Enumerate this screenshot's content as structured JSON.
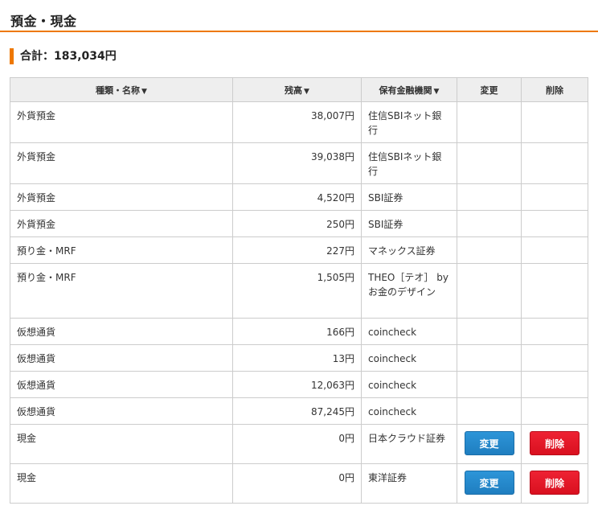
{
  "page": {
    "title": "預金・現金",
    "total": "合計：183,034円"
  },
  "table": {
    "headers": {
      "type_name": "種類・名称",
      "balance": "残高",
      "institution": "保有金融機関",
      "edit": "変更",
      "delete": "削除"
    },
    "sort_arrow": "▼",
    "rows": [
      {
        "type": "外貨預金",
        "amount": "38,007円",
        "institution": "住信SBIネット銀行",
        "actions": false
      },
      {
        "type": "外貨預金",
        "amount": "39,038円",
        "institution": "住信SBIネット銀行",
        "actions": false
      },
      {
        "type": "外貨預金",
        "amount": "4,520円",
        "institution": "SBI証券",
        "actions": false
      },
      {
        "type": "外貨預金",
        "amount": "250円",
        "institution": "SBI証券",
        "actions": false
      },
      {
        "type": "預り金・MRF",
        "amount": "227円",
        "institution": "マネックス証券",
        "actions": false
      },
      {
        "type": "預り金・MRF",
        "amount": "1,505円",
        "institution": "THEO［テオ］ by お金のデザイン",
        "actions": false
      },
      {
        "type": "仮想通貨",
        "amount": "166円",
        "institution": "coincheck",
        "actions": false
      },
      {
        "type": "仮想通貨",
        "amount": "13円",
        "institution": "coincheck",
        "actions": false
      },
      {
        "type": "仮想通貨",
        "amount": "12,063円",
        "institution": "coincheck",
        "actions": false
      },
      {
        "type": "仮想通貨",
        "amount": "87,245円",
        "institution": "coincheck",
        "actions": false
      },
      {
        "type": "現金",
        "amount": "0円",
        "institution": "日本クラウド証券",
        "actions": true
      },
      {
        "type": "現金",
        "amount": "0円",
        "institution": "東洋証券",
        "actions": true
      }
    ],
    "edit_button": "変更",
    "delete_button": "削除"
  },
  "colors": {
    "accent": "#ee7800",
    "edit_button": "#1f7ec0",
    "delete_button": "#d9101f"
  }
}
